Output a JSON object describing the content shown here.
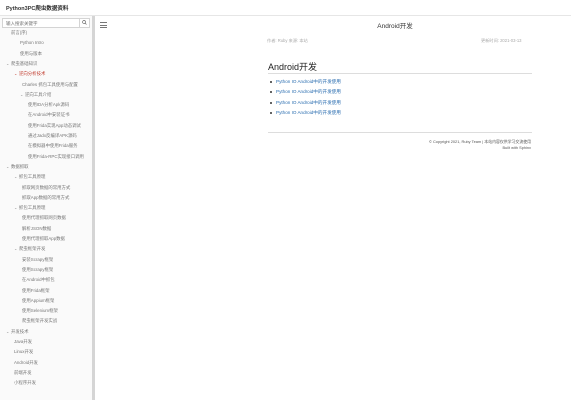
{
  "site": {
    "title": "Python3PC爬虫数据资料"
  },
  "search": {
    "placeholder": "输入搜索关键字"
  },
  "sidebar": {
    "items": [
      {
        "label": "前言(序)",
        "chevron": ""
      },
      {
        "label": "Python Intro",
        "chevron": ""
      },
      {
        "label": "使用与版本",
        "chevron": ""
      },
      {
        "label": "爬虫基础知识",
        "chevron": "⌄"
      },
      {
        "label": "逆向分析技术",
        "chevron": "⌄",
        "active": true
      },
      {
        "label": "Charles 抓包工具使用与配置",
        "chevron": ""
      },
      {
        "label": "逆向工具介绍",
        "chevron": "⌄"
      },
      {
        "label": "使用IDA分析Apk源码",
        "chevron": ""
      },
      {
        "label": "在Android中安装证书",
        "chevron": ""
      },
      {
        "label": "使用Frida实现App动态调试",
        "chevron": ""
      },
      {
        "label": "通过Jadx反编译APK源码",
        "chevron": ""
      },
      {
        "label": "在模拟器中使用Frida服务",
        "chevron": ""
      },
      {
        "label": "使用Frida-RPC实现接口调用",
        "chevron": ""
      },
      {
        "label": "数据抓取",
        "chevron": "⌄"
      },
      {
        "label": "抓包工具原理",
        "chevron": "⌄"
      },
      {
        "label": "抓取网页数据的常用方式",
        "chevron": ""
      },
      {
        "label": "抓取App数据的常用方式",
        "chevron": ""
      },
      {
        "label": "抓包工具原理",
        "chevron": "⌄"
      },
      {
        "label": "使用代理抓取网页数据",
        "chevron": ""
      },
      {
        "label": "解析JSON数据",
        "chevron": ""
      },
      {
        "label": "使用代理抓取App数据",
        "chevron": ""
      },
      {
        "label": "爬虫框架开发",
        "chevron": "⌄"
      },
      {
        "label": "安装Scrapy框架",
        "chevron": ""
      },
      {
        "label": "使用Scrapy框架",
        "chevron": ""
      },
      {
        "label": "在Android中抓包",
        "chevron": ""
      },
      {
        "label": "使用Frida框架",
        "chevron": ""
      },
      {
        "label": "使用Appium框架",
        "chevron": ""
      },
      {
        "label": "使用Selenium框架",
        "chevron": ""
      },
      {
        "label": "爬虫框架开发实战",
        "chevron": ""
      },
      {
        "label": "开发技术",
        "chevron": "⌄"
      },
      {
        "label": "Java开发",
        "chevron": ""
      },
      {
        "label": "Linux开发",
        "chevron": ""
      },
      {
        "label": "Android开发",
        "chevron": ""
      },
      {
        "label": "前端开发",
        "chevron": ""
      },
      {
        "label": "小程序开发",
        "chevron": ""
      }
    ]
  },
  "main": {
    "title": "Android开发",
    "meta_left": "作者: Ruby  来源: 本站",
    "meta_right": "更新时间: 2021-03-13",
    "heading": "Android开发",
    "links": [
      "Python IO Android中的开发使用",
      "Python IO Android中的开发使用",
      "Python IO Android中的开发使用",
      "Python IO Android中的开发使用"
    ],
    "footer_line1": "© Copyright 2021, Ruby Team  |  本站内容仅供学习交流使用",
    "footer_line2": "Built with Sphinx"
  }
}
